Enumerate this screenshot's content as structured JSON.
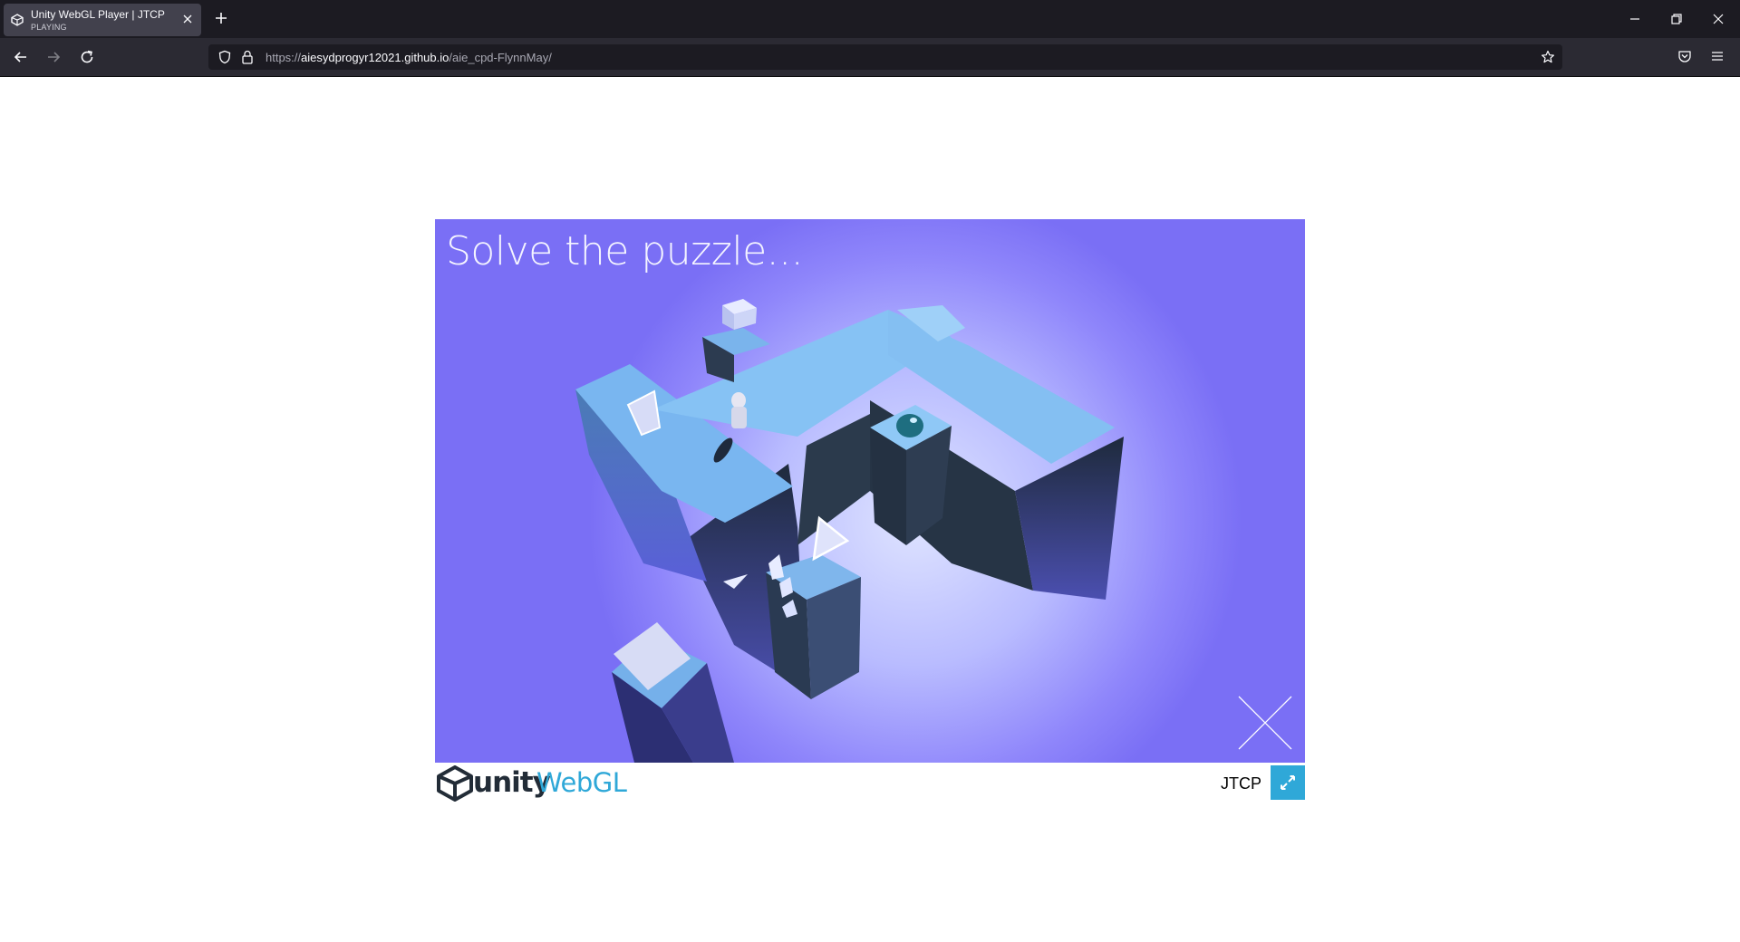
{
  "browser": {
    "tab": {
      "title": "Unity WebGL Player | JTCP",
      "subtitle": "PLAYING"
    },
    "url": {
      "prefix": "https://",
      "host": "aiesydprogyr12021.github.io",
      "path": "/aie_cpd-FlynnMay/"
    }
  },
  "page": {
    "game": {
      "headline": "Solve the puzzle..."
    },
    "footer": {
      "brand": "unity",
      "brand_product": "WebGL",
      "title": "JTCP"
    },
    "colors": {
      "scene_bg": "#7a6ff5",
      "accent": "#2fa8d8"
    }
  }
}
